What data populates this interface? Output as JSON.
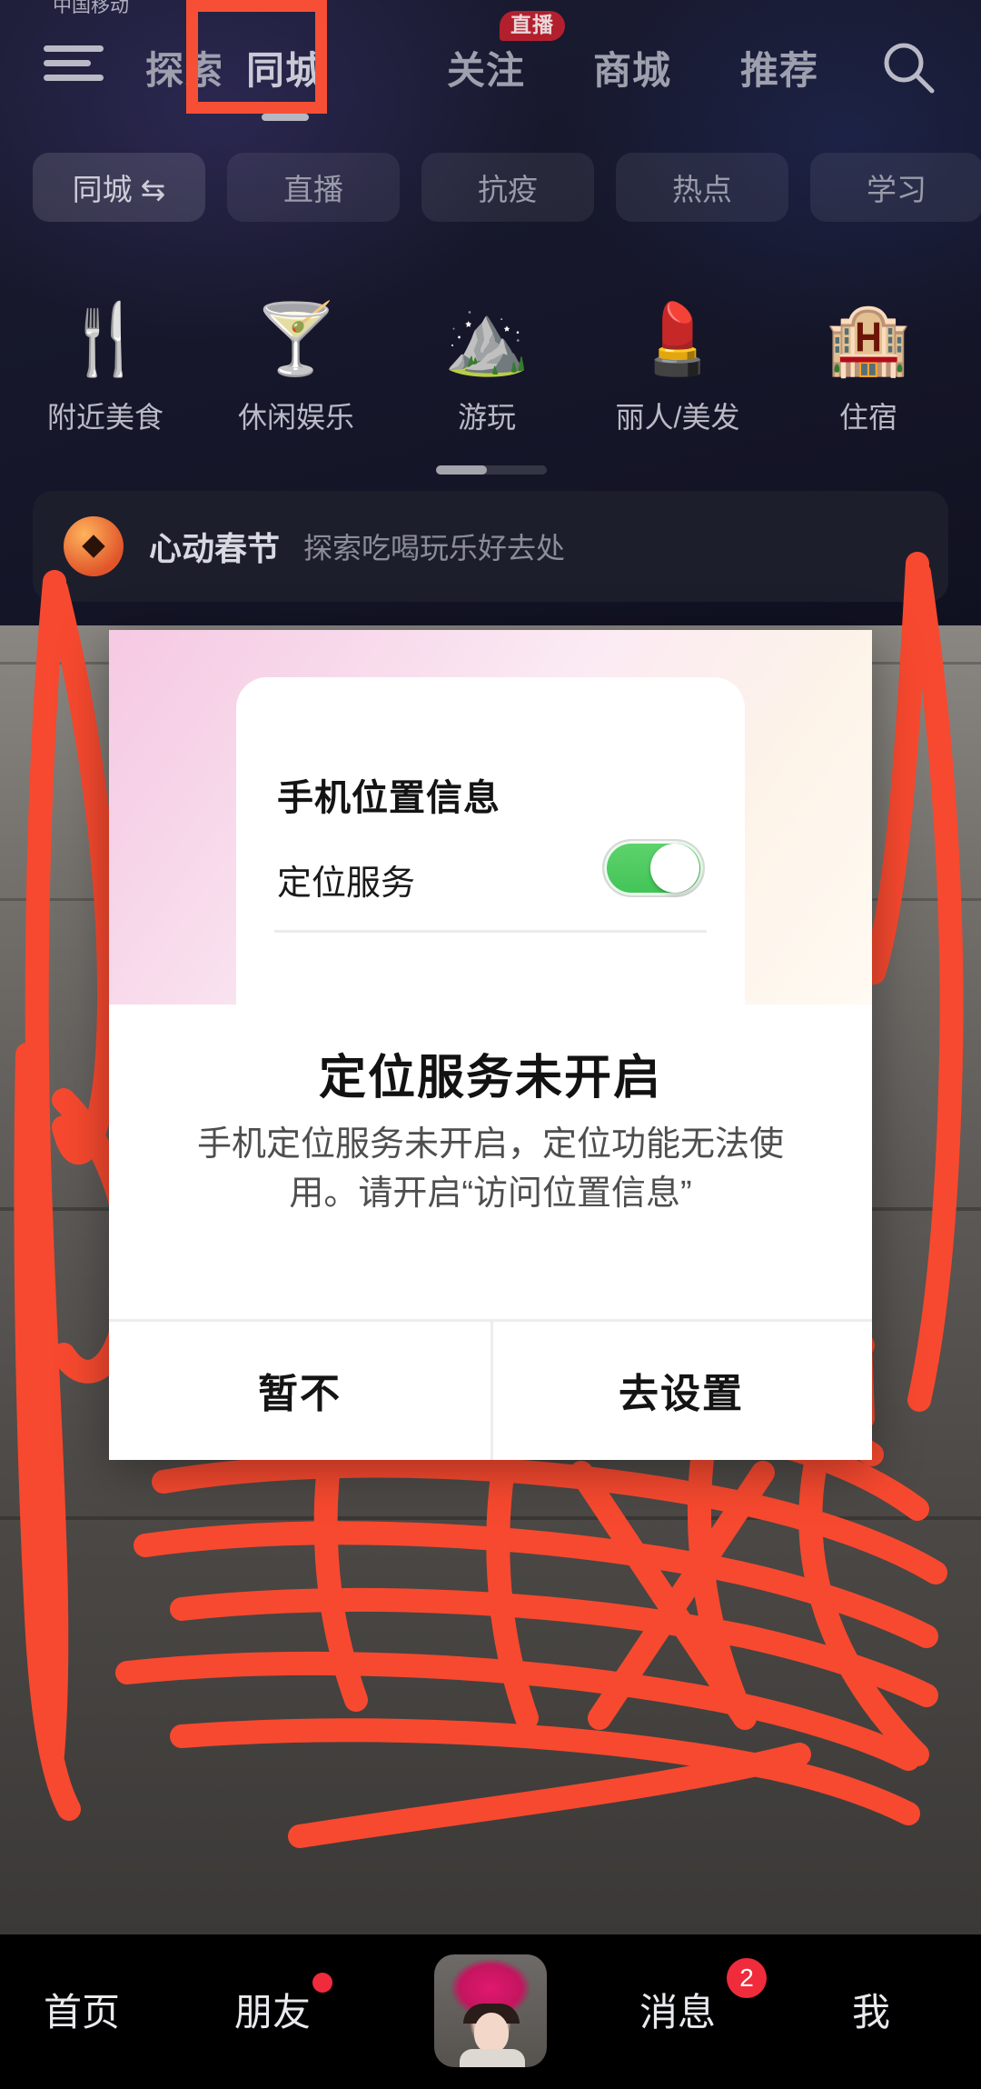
{
  "status_bar": {
    "text": "中国移动 "
  },
  "nav": {
    "menu_icon": "hamburger-menu-icon",
    "search_icon": "search-icon",
    "tabs": [
      {
        "label": "探索",
        "active": false,
        "badge": ""
      },
      {
        "label": "同城",
        "active": true,
        "badge": ""
      },
      {
        "label": "关注",
        "active": false,
        "badge": "直播"
      },
      {
        "label": "商城",
        "active": false,
        "badge": ""
      },
      {
        "label": "推荐",
        "active": false,
        "badge": ""
      }
    ]
  },
  "chips": [
    {
      "label": "同城 ⇆",
      "selected": true
    },
    {
      "label": "直播",
      "selected": false
    },
    {
      "label": "抗疫",
      "selected": false
    },
    {
      "label": "热点",
      "selected": false
    },
    {
      "label": "学习",
      "selected": false
    }
  ],
  "services": [
    {
      "label": "附近美食",
      "icon": "fork-spoon-icon",
      "glyph": "🍴"
    },
    {
      "label": "休闲娱乐",
      "icon": "cocktail-icon",
      "glyph": "🍸"
    },
    {
      "label": "游玩",
      "icon": "mountains-icon",
      "glyph": "⛰"
    },
    {
      "label": "丽人/美发",
      "icon": "beauty-mirror-icon",
      "glyph": "💄"
    },
    {
      "label": "住宿",
      "icon": "hotel-building-icon",
      "glyph": "🏨"
    }
  ],
  "promo": {
    "icon": "lantern-icon",
    "title": "心动春节",
    "subtitle": "探索吃喝玩乐好去处"
  },
  "dialog": {
    "card": {
      "heading": "手机位置信息",
      "row_label": "定位服务",
      "toggle_state": "on",
      "toggle_color": "#4bc75d"
    },
    "title": "定位服务未开启",
    "message": "手机定位服务未开启，定位功能无法使用。请开启“访问位置信息”",
    "buttons": [
      {
        "label": "暂不",
        "role": "dismiss"
      },
      {
        "label": "去设置",
        "role": "confirm"
      }
    ]
  },
  "annotations": {
    "color": "#f74f35",
    "boxes": [
      {
        "target": "同城",
        "name": "tongcheng-tab-highlight"
      },
      {
        "target": "去设置",
        "name": "go-settings-highlight"
      }
    ],
    "scribble": "red-marker-scribble"
  },
  "bottom_nav": [
    {
      "label": "首页",
      "badge": "",
      "badge_type": "none"
    },
    {
      "label": "朋友",
      "badge": "",
      "badge_type": "dot"
    },
    {
      "label": "",
      "badge": "",
      "badge_type": "avatar",
      "icon": "user-avatar"
    },
    {
      "label": "消息",
      "badge": "2",
      "badge_type": "count"
    },
    {
      "label": "我",
      "badge": "",
      "badge_type": "none"
    }
  ]
}
